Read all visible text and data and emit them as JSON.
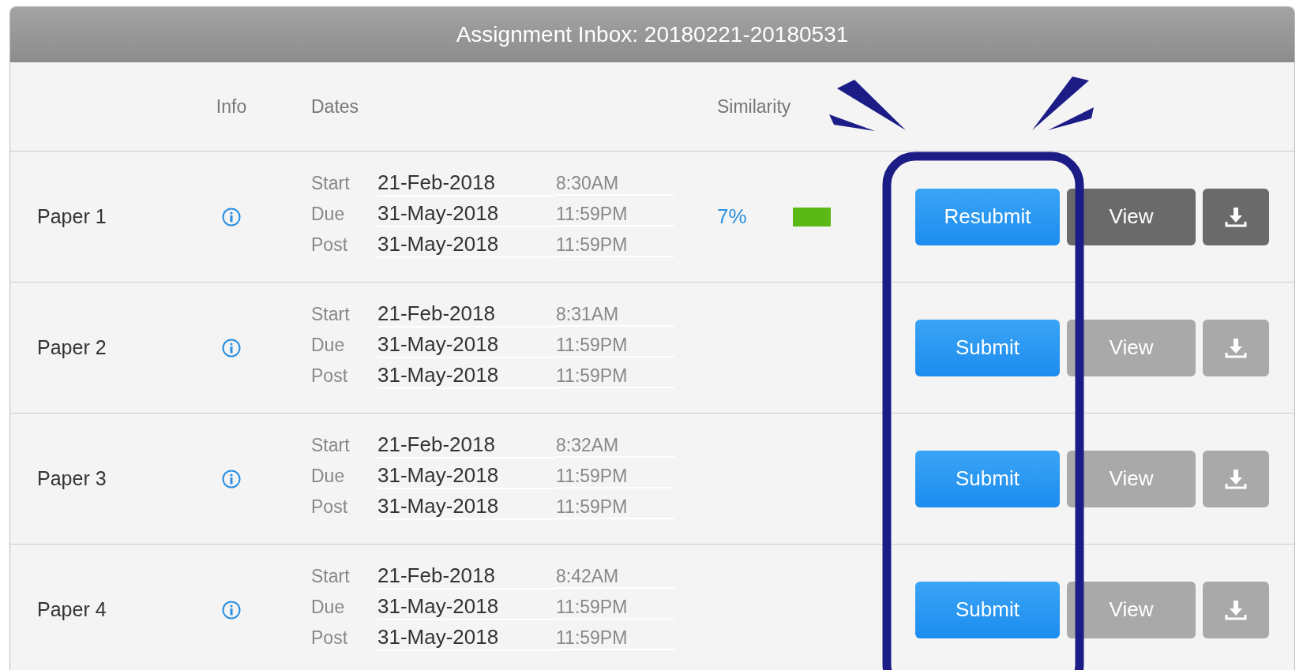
{
  "title": "Assignment Inbox: 20180221-20180531",
  "columns": {
    "info": "Info",
    "dates": "Dates",
    "similarity": "Similarity"
  },
  "rows": [
    {
      "name": "Paper 1",
      "dates": [
        {
          "label": "Start",
          "date": "21-Feb-2018",
          "time": "8:30AM"
        },
        {
          "label": "Due",
          "date": "31-May-2018",
          "time": "11:59PM"
        },
        {
          "label": "Post",
          "date": "31-May-2018",
          "time": "11:59PM"
        }
      ],
      "similarity": {
        "score": "7%",
        "color": "#5cb814"
      },
      "submit": "Resubmit",
      "view": "View",
      "view_enabled": true
    },
    {
      "name": "Paper 2",
      "dates": [
        {
          "label": "Start",
          "date": "21-Feb-2018",
          "time": "8:31AM"
        },
        {
          "label": "Due",
          "date": "31-May-2018",
          "time": "11:59PM"
        },
        {
          "label": "Post",
          "date": "31-May-2018",
          "time": "11:59PM"
        }
      ],
      "submit": "Submit",
      "view": "View",
      "view_enabled": false
    },
    {
      "name": "Paper 3",
      "dates": [
        {
          "label": "Start",
          "date": "21-Feb-2018",
          "time": "8:32AM"
        },
        {
          "label": "Due",
          "date": "31-May-2018",
          "time": "11:59PM"
        },
        {
          "label": "Post",
          "date": "31-May-2018",
          "time": "11:59PM"
        }
      ],
      "submit": "Submit",
      "view": "View",
      "view_enabled": false
    },
    {
      "name": "Paper 4",
      "dates": [
        {
          "label": "Start",
          "date": "21-Feb-2018",
          "time": "8:42AM"
        },
        {
          "label": "Due",
          "date": "31-May-2018",
          "time": "11:59PM"
        },
        {
          "label": "Post",
          "date": "31-May-2018",
          "time": "11:59PM"
        }
      ],
      "submit": "Submit",
      "view": "View",
      "view_enabled": false
    }
  ]
}
